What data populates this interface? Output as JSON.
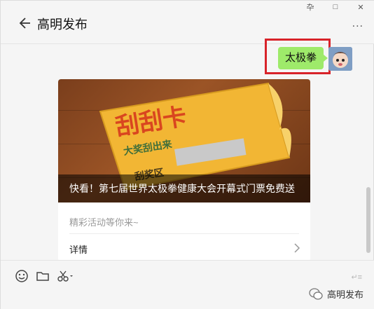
{
  "window_controls": [
    "卆",
    "□",
    "✕"
  ],
  "header": {
    "title": "高明发布",
    "more_label": "..."
  },
  "message": {
    "text": "太极拳",
    "bubble_color": "#9eea6a",
    "highlight_color": "#d8232a"
  },
  "card": {
    "cover_heading": "刮刮卡",
    "cover_sub": "大奖刮出来",
    "cover_zone": "刮奖区",
    "caption": "快看！第七届世界太极拳健康大会开幕式门票免费送",
    "description": "精彩活动等你来~",
    "details_label": "详情"
  },
  "input": {
    "send_hint": "↵≡",
    "watermark": "高明发布"
  },
  "icons": [
    "back-arrow-icon",
    "more-icon",
    "emoji-icon",
    "folder-icon",
    "scissors-icon",
    "chevron-right-icon",
    "wechat-icon"
  ]
}
